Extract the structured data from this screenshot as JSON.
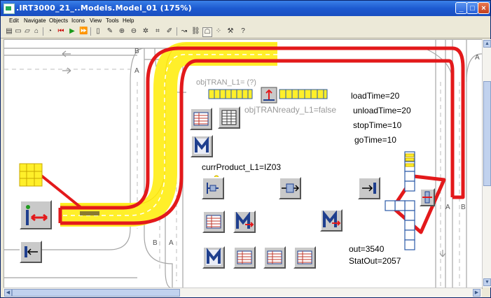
{
  "window": {
    "title": ".IRT3000_21_..Models.Model_01  (175%)",
    "buttons": {
      "minimize": "_",
      "maximize": "□",
      "close": "×"
    }
  },
  "menu": {
    "items": [
      "Edit",
      "Navigate",
      "Objects",
      "Icons",
      "View",
      "Tools",
      "Help"
    ]
  },
  "toolbar": {
    "icons": [
      "book-icon",
      "folder-icon",
      "home-icon",
      "stopwatch-icon",
      "rewind-icon",
      "play-icon",
      "fast-forward-icon",
      "clipboard-icon",
      "brush-icon",
      "zoom-in-icon",
      "zoom-out-icon",
      "zoom-fit-icon",
      "crop-icon",
      "edit-icon",
      "route-icon",
      "link-icon",
      "comment-icon",
      "grid-icon",
      "walker-icon",
      "help-icon"
    ]
  },
  "canvas": {
    "labels": {
      "obj_tran": "objTRAN_L1= (?)",
      "obj_tran_ready": "objTRANready_L1=false",
      "load_time": "loadTime=20",
      "unload_time": "unloadTime=20",
      "stop_time": "stopTime=10",
      "go_time": "goTime=10",
      "curr_product": "currProduct_L1=IZ03",
      "out": "out=3540",
      "stat_out": "StatOut=2057"
    },
    "track_letters": {
      "top_b": "B",
      "top_a": "A",
      "bottom_b": "B",
      "bottom_a": "A",
      "right_a": "A",
      "right_b": "B",
      "far_a": "A"
    },
    "colors": {
      "path_red": "#e3191b",
      "path_yellow": "#ffef2a",
      "icon_blue": "#1f3f8e",
      "rail_gray": "#9a9a9a"
    }
  }
}
